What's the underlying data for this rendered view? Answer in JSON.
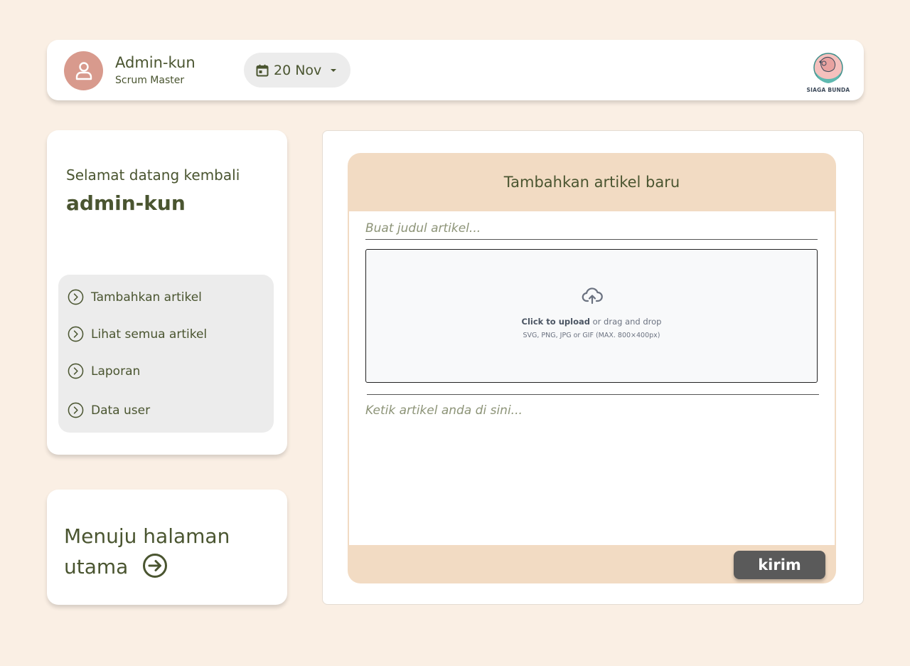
{
  "header": {
    "user_name": "Admin-kun",
    "user_role": "Scrum Master",
    "date_label": "20 Nov",
    "logo_text": "SIAGA BUNDA",
    "icons": {
      "avatar": "user-icon",
      "date": "calendar-icon",
      "dropdown": "caret-down-icon",
      "logo": "siaga-bunda-logo"
    }
  },
  "welcome": {
    "greeting": "Selamat datang kembali",
    "name": "admin-kun"
  },
  "menu": {
    "items": [
      {
        "label": "Tambahkan artikel",
        "icon": "chevron-circle-right-icon"
      },
      {
        "label": "Lihat semua artikel",
        "icon": "chevron-circle-right-icon"
      },
      {
        "label": "Laporan",
        "icon": "chevron-circle-right-icon"
      },
      {
        "label": "Data user",
        "icon": "chevron-circle-right-icon"
      }
    ]
  },
  "home_link": {
    "line1": "Menuju halaman",
    "line2": "utama",
    "icon": "arrow-circle-right-icon"
  },
  "editor": {
    "heading": "Tambahkan artikel baru",
    "title_placeholder": "Buat judul artikel...",
    "upload": {
      "click_text": "Click to upload",
      "rest_text": " or drag and drop",
      "formats": "SVG, PNG, JPG or GIF (MAX. 800×400px)",
      "icon": "cloud-upload-icon"
    },
    "body_placeholder": "Ketik artikel anda di sini...",
    "submit_label": "kirim"
  },
  "colors": {
    "background": "#faefe4",
    "text": "#4a5530",
    "avatar": "#d89a8d",
    "editor_frame": "#f2dbc3",
    "submit": "#5a5a5a"
  }
}
